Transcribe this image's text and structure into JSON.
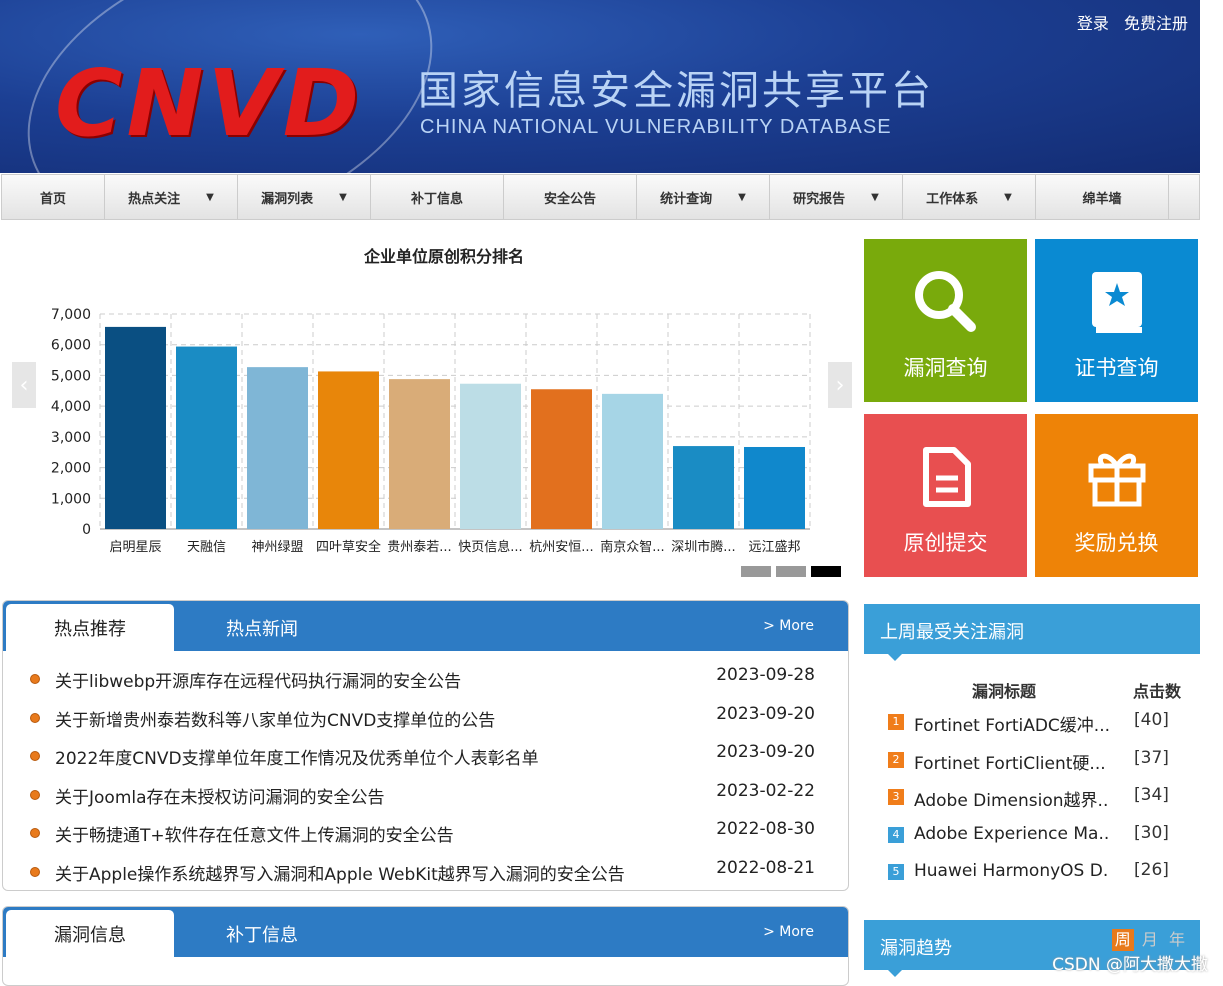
{
  "header": {
    "logo": "CNVD",
    "title_cn": "国家信息安全漏洞共享平台",
    "title_en": "CHINA NATIONAL VULNERABILITY DATABASE",
    "login": "登录",
    "register": "免费注册"
  },
  "nav": [
    {
      "label": "首页",
      "dropdown": false
    },
    {
      "label": "热点关注",
      "dropdown": true
    },
    {
      "label": "漏洞列表",
      "dropdown": true
    },
    {
      "label": "补丁信息",
      "dropdown": false
    },
    {
      "label": "安全公告",
      "dropdown": false
    },
    {
      "label": "统计查询",
      "dropdown": true
    },
    {
      "label": "研究报告",
      "dropdown": true
    },
    {
      "label": "工作体系",
      "dropdown": true
    },
    {
      "label": "绵羊墙",
      "dropdown": false
    }
  ],
  "chart_data": {
    "type": "bar",
    "title": "企业单位原创积分排名",
    "categories": [
      "启明星辰",
      "天融信",
      "神州绿盟",
      "四叶草安全",
      "贵州泰若...",
      "快页信息...",
      "杭州安恒...",
      "南京众智...",
      "深圳市腾...",
      "远江盛邦"
    ],
    "values": [
      6580,
      5940,
      5270,
      5130,
      4880,
      4730,
      4550,
      4400,
      2700,
      2670
    ],
    "colors": [
      "#0a4f82",
      "#1a8cc4",
      "#7fb6d6",
      "#e8860a",
      "#d9ac78",
      "#bcdde6",
      "#e2701e",
      "#a6d5e6",
      "#1a8cc4",
      "#1088cc"
    ],
    "ylim": [
      0,
      7000
    ],
    "yticks": [
      "0",
      "1,000",
      "2,000",
      "3,000",
      "4,000",
      "5,000",
      "6,000",
      "7,000"
    ],
    "grid": true
  },
  "chart_nav": {
    "prev": "‹",
    "next": "›"
  },
  "tiles": [
    {
      "label": "漏洞查询",
      "color": "#79aa0c",
      "icon": "search-icon"
    },
    {
      "label": "证书查询",
      "color": "#0a8ad2",
      "icon": "certificate-book-icon"
    },
    {
      "label": "原创提交",
      "color": "#e84f50",
      "icon": "document-icon"
    },
    {
      "label": "奖励兑换",
      "color": "#ee8307",
      "icon": "gift-icon"
    }
  ],
  "news_panel": {
    "tab_active": "热点推荐",
    "tab_inactive": "热点新闻",
    "more": "> More",
    "items": [
      {
        "title": "关于libwebp开源库存在远程代码执行漏洞的安全公告",
        "date": "2023-09-28"
      },
      {
        "title": "关于新增贵州泰若数科等八家单位为CNVD支撑单位的公告",
        "date": "2023-09-20"
      },
      {
        "title": "2022年度CNVD支撑单位年度工作情况及优秀单位个人表彰名单",
        "date": "2023-09-20"
      },
      {
        "title": "关于Joomla存在未授权访问漏洞的安全公告",
        "date": "2023-02-22"
      },
      {
        "title": "关于畅捷通T+软件存在任意文件上传漏洞的安全公告",
        "date": "2022-08-30"
      },
      {
        "title": "关于Apple操作系统越界写入漏洞和Apple WebKit越界写入漏洞的安全公告",
        "date": "2022-08-21"
      }
    ]
  },
  "vuln_panel": {
    "tab_active": "漏洞信息",
    "tab_inactive": "补丁信息",
    "more": "> More"
  },
  "hot_vulns": {
    "title": "上周最受关注漏洞",
    "col_title": "漏洞标题",
    "col_clicks": "点击数",
    "items": [
      {
        "rank": "1",
        "name": "Fortinet FortiADC缓冲...",
        "clicks": "[40]",
        "color": "#f07d1a"
      },
      {
        "rank": "2",
        "name": "Fortinet FortiClient硬...",
        "clicks": "[37]",
        "color": "#f07d1a"
      },
      {
        "rank": "3",
        "name": "Adobe Dimension越界...",
        "clicks": "[34]",
        "color": "#f07d1a"
      },
      {
        "rank": "4",
        "name": "Adobe Experience Ma...",
        "clicks": "[30]",
        "color": "#3a9fd8"
      },
      {
        "rank": "5",
        "name": "Huawei HarmonyOS D...",
        "clicks": "[26]",
        "color": "#3a9fd8"
      }
    ]
  },
  "trend": {
    "title": "漏洞趋势",
    "periods": [
      "周",
      "月",
      "年"
    ]
  },
  "watermark": "CSDN @阿大撒大撒"
}
